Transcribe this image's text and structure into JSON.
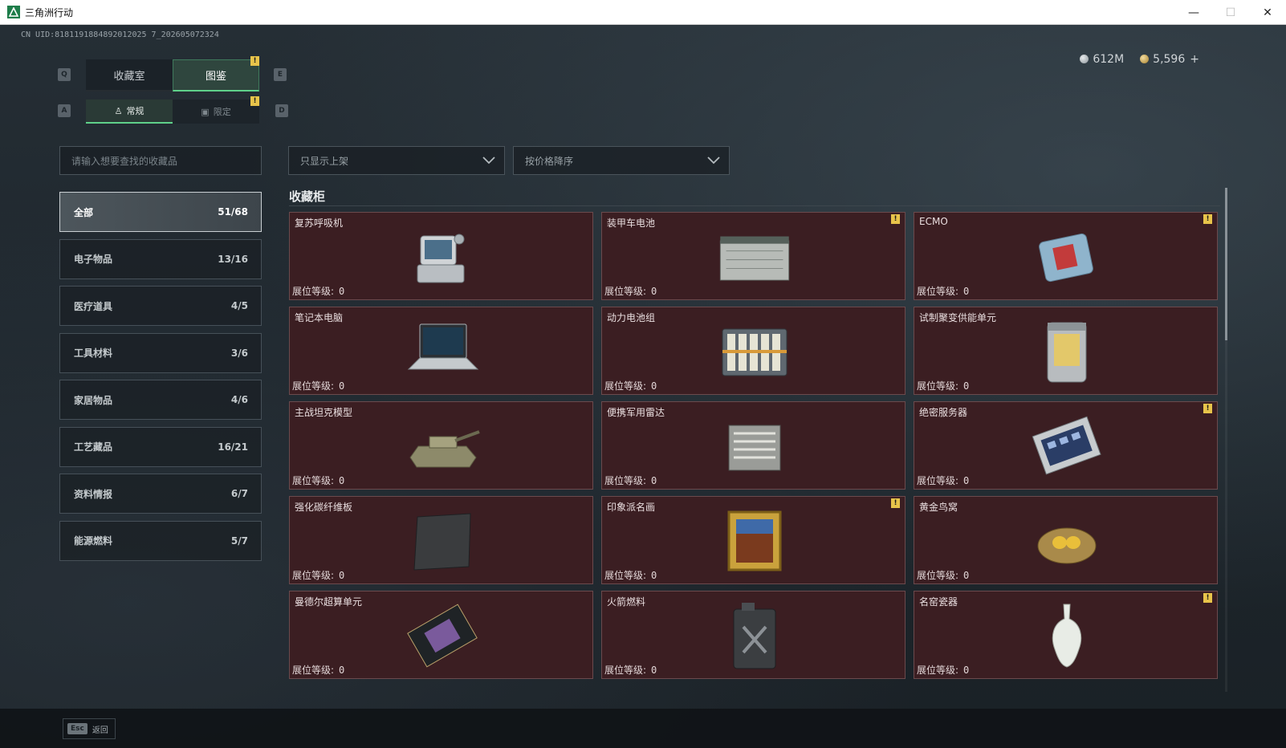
{
  "window": {
    "title": "三角洲行动",
    "min": "—",
    "max": "☐",
    "close": "✕"
  },
  "uid": "CN UID:8181191884892012025 7_202605072324",
  "currency": {
    "silver": "612M",
    "gold": "5,596",
    "plus": "+"
  },
  "keys": {
    "prev_tab": "Q",
    "next_tab": "E",
    "prev_sub": "A",
    "next_sub": "D",
    "warn": "!"
  },
  "tabs": [
    {
      "label": "收藏室"
    },
    {
      "label": "图鉴"
    }
  ],
  "subtabs": [
    {
      "label": "常规"
    },
    {
      "label": "限定"
    }
  ],
  "search": {
    "placeholder": "请输入想要查找的收藏品"
  },
  "filters": {
    "shelf": "只显示上架",
    "sort": "按价格降序"
  },
  "categories": [
    {
      "label": "全部",
      "count": "51/68"
    },
    {
      "label": "电子物品",
      "count": "13/16"
    },
    {
      "label": "医疗道具",
      "count": "4/5"
    },
    {
      "label": "工具材料",
      "count": "3/6"
    },
    {
      "label": "家居物品",
      "count": "4/6"
    },
    {
      "label": "工艺藏品",
      "count": "16/21"
    },
    {
      "label": "资料情报",
      "count": "6/7"
    },
    {
      "label": "能源燃料",
      "count": "5/7"
    }
  ],
  "section_title": "收藏柜",
  "level_label": "展位等级:",
  "items": [
    {
      "name": "复苏呼吸机",
      "level": "0",
      "icon": "ventilator-icon",
      "warn": false
    },
    {
      "name": "装甲车电池",
      "level": "0",
      "icon": "battery-icon",
      "warn": true
    },
    {
      "name": "ECMO",
      "level": "0",
      "icon": "ecmo-icon",
      "warn": true
    },
    {
      "name": "笔记本电脑",
      "level": "0",
      "icon": "laptop-icon",
      "warn": false
    },
    {
      "name": "动力电池组",
      "level": "0",
      "icon": "battery-pack-icon",
      "warn": false
    },
    {
      "name": "试制聚变供能单元",
      "level": "0",
      "icon": "fusion-unit-icon",
      "warn": false
    },
    {
      "name": "主战坦克模型",
      "level": "0",
      "icon": "tank-icon",
      "warn": false
    },
    {
      "name": "便携军用雷达",
      "level": "0",
      "icon": "radar-icon",
      "warn": false
    },
    {
      "name": "绝密服务器",
      "level": "0",
      "icon": "server-icon",
      "warn": true
    },
    {
      "name": "强化碳纤维板",
      "level": "0",
      "icon": "carbon-plate-icon",
      "warn": false
    },
    {
      "name": "印象派名画",
      "level": "0",
      "icon": "painting-icon",
      "warn": true
    },
    {
      "name": "黄金鸟窝",
      "level": "0",
      "icon": "golden-nest-icon",
      "warn": false
    },
    {
      "name": "曼德尔超算单元",
      "level": "0",
      "icon": "gpu-icon",
      "warn": false
    },
    {
      "name": "火箭燃料",
      "level": "0",
      "icon": "fuel-can-icon",
      "warn": false
    },
    {
      "name": "名窑瓷器",
      "level": "0",
      "icon": "vase-icon",
      "warn": true
    }
  ],
  "footer": {
    "esc_key": "Esc",
    "back_label": "返回"
  },
  "colors": {
    "accent": "#5fd18a",
    "card_bg": "#3b1e22",
    "warn": "#e8c44a"
  }
}
